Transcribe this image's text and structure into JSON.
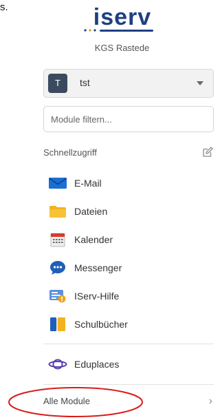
{
  "edge_fragment": "s.",
  "brand": {
    "logo_text": "iserv",
    "school": "KGS Rastede"
  },
  "account": {
    "initial": "T",
    "name": "tst"
  },
  "filter": {
    "placeholder": "Module filtern..."
  },
  "quick_access": {
    "title": "Schnellzugriff",
    "items": [
      {
        "label": "E-Mail",
        "icon": "mail-icon"
      },
      {
        "label": "Dateien",
        "icon": "folder-icon"
      },
      {
        "label": "Kalender",
        "icon": "calendar-icon"
      },
      {
        "label": "Messenger",
        "icon": "chat-icon"
      },
      {
        "label": "IServ-Hilfe",
        "icon": "help-icon"
      },
      {
        "label": "Schulbücher",
        "icon": "books-icon"
      }
    ]
  },
  "extra": {
    "label": "Eduplaces",
    "icon": "planet-icon"
  },
  "all_modules": {
    "label": "Alle Module"
  },
  "colors": {
    "brand": "#1f3f83",
    "annotation": "#d91a1a"
  }
}
